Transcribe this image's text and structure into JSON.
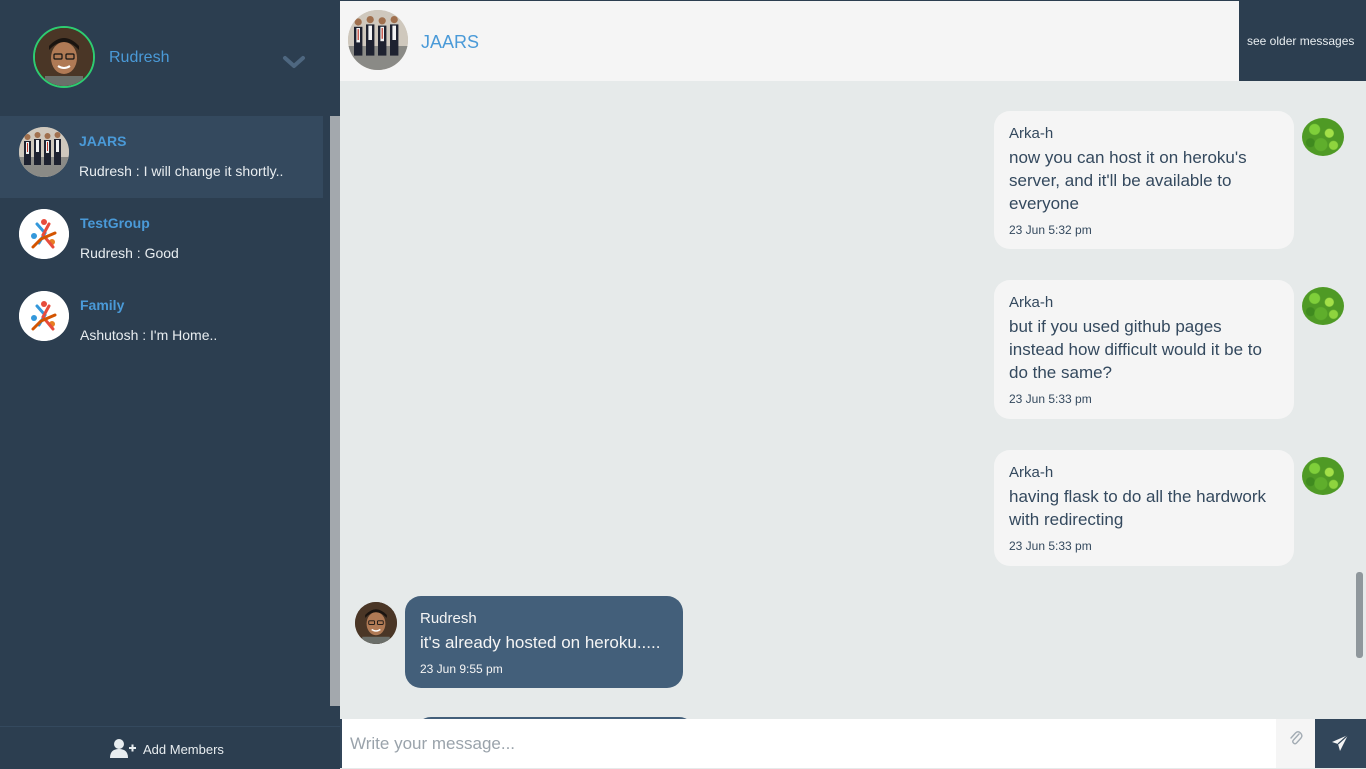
{
  "user": {
    "name": "Rudresh"
  },
  "contacts": [
    {
      "name": "JAARS",
      "preview": "Rudresh : I will change it shortly..",
      "active": true,
      "avatar": "group-photo"
    },
    {
      "name": "TestGroup",
      "preview": "Rudresh : Good",
      "active": false,
      "avatar": "default-group-logo"
    },
    {
      "name": "Family",
      "preview": "Ashutosh : I'm Home..",
      "active": false,
      "avatar": "default-group-logo"
    }
  ],
  "sidebar_footer": {
    "add_members_label": "Add Members"
  },
  "chat": {
    "title": "JAARS",
    "older_messages_label": "see older messages",
    "messages": [
      {
        "sender": "Arka-h",
        "text": "now you can host it on heroku's server, and it'll be available to everyone",
        "time": "23 Jun 5:32 pm",
        "direction": "incoming"
      },
      {
        "sender": "Arka-h",
        "text": "but if you used github pages instead how difficult would it be to do the same?",
        "time": "23 Jun 5:33 pm",
        "direction": "incoming"
      },
      {
        "sender": "Arka-h",
        "text": "having flask to do all the hardwork with redirecting",
        "time": "23 Jun 5:33 pm",
        "direction": "incoming"
      },
      {
        "sender": "Rudresh",
        "text": "it's already hosted on heroku.....",
        "time": "23 Jun 9:55 pm",
        "direction": "outgoing"
      }
    ]
  },
  "composer": {
    "placeholder": "Write your message...",
    "value": ""
  },
  "colors": {
    "sidebar_bg": "#2c3e50",
    "accent": "#4a9ad8",
    "status_online": "#2ecc71",
    "outgoing_bubble": "#435f7a",
    "incoming_bubble": "#f5f5f5"
  },
  "icons": [
    "chevron-down-icon",
    "add-user-icon",
    "paperclip-icon",
    "send-icon"
  ]
}
